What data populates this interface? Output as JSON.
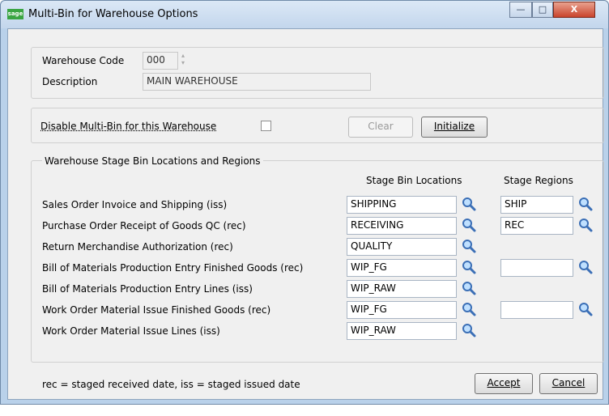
{
  "window": {
    "title": "Multi-Bin for Warehouse Options",
    "app_icon_text": "sage",
    "minimize_glyph": "—",
    "maximize_glyph": "□",
    "close_glyph": "X"
  },
  "warehouse": {
    "code_label": "Warehouse Code",
    "code_value": "000",
    "description_label": "Description",
    "description_value": "MAIN WAREHOUSE"
  },
  "multibin": {
    "disable_label": "Disable Multi-Bin for this Warehouse",
    "disable_checked": false,
    "clear_label": "Clear",
    "initialize_label": "Initialize"
  },
  "stage": {
    "group_title": "Warehouse Stage Bin Locations and Regions",
    "col_bin": "Stage Bin Locations",
    "col_region": "Stage Regions",
    "rows": [
      {
        "label": "Sales Order Invoice and Shipping (iss)",
        "bin": "SHIPPING",
        "region": "SHIP"
      },
      {
        "label": "Purchase Order Receipt of Goods QC (rec)",
        "bin": "RECEIVING",
        "region": "REC"
      },
      {
        "label": "Return Merchandise Authorization (rec)",
        "bin": "QUALITY",
        "region": null
      },
      {
        "label": "Bill of Materials Production Entry Finished Goods (rec)",
        "bin": "WIP_FG",
        "region": ""
      },
      {
        "label": "Bill of Materials Production Entry Lines (iss)",
        "bin": "WIP_RAW",
        "region": null
      },
      {
        "label": "Work Order Material Issue Finished Goods (rec)",
        "bin": "WIP_FG",
        "region": ""
      },
      {
        "label": "Work Order Material Issue Lines (iss)",
        "bin": "WIP_RAW",
        "region": null
      }
    ]
  },
  "footer": {
    "legend_text": "rec = staged received date, iss = staged issued date",
    "accept_label": "Accept",
    "cancel_label": "Cancel"
  },
  "icons": {
    "lookup": "search-icon",
    "accent_blue": "#3b6fb6",
    "lens_fill": "#bfe0ff"
  }
}
